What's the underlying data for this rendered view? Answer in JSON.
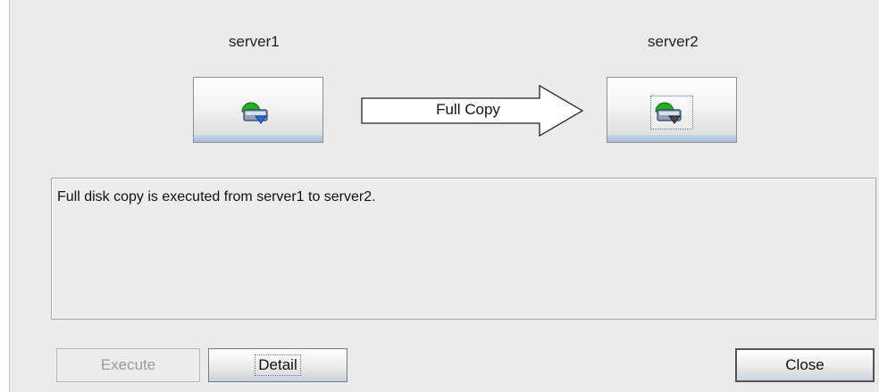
{
  "servers": {
    "source": {
      "label": "server1",
      "icon": "disk-server-icon"
    },
    "target": {
      "label": "server2",
      "icon": "disk-server-icon"
    }
  },
  "operation": {
    "label": "Full Copy",
    "icon": "right-arrow-icon"
  },
  "message": "Full disk copy is executed from server1 to server2.",
  "buttons": {
    "execute": "Execute",
    "detail": "Detail",
    "close": "Close"
  },
  "colors": {
    "background": "#ebebeb",
    "button_accent": "#b8cbe0",
    "icon_green": "#22aa22",
    "icon_blue": "#1e5fd0",
    "disabled_text": "#9b9b9b"
  }
}
